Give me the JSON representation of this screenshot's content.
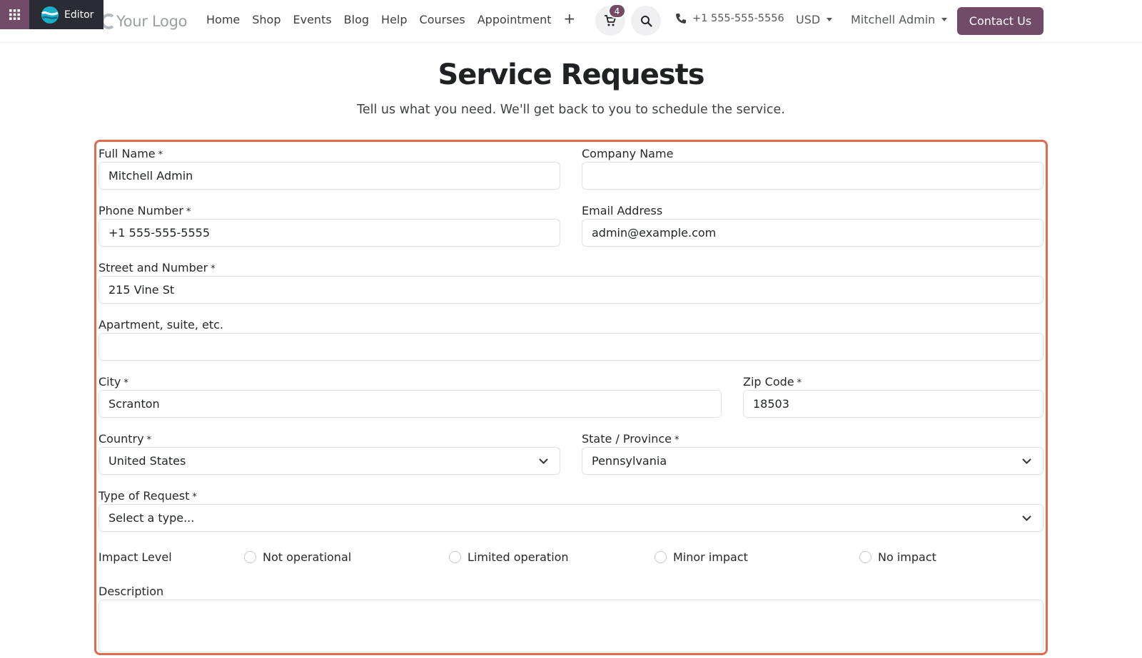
{
  "editor": {
    "label": "Editor"
  },
  "header": {
    "logo_text": "Your Logo",
    "nav": [
      "Home",
      "Shop",
      "Events",
      "Blog",
      "Help",
      "Courses",
      "Appointment"
    ],
    "nav_add": "+",
    "cart_count": "4",
    "phone": "+1 555-555-5556",
    "currency": "USD",
    "user": "Mitchell Admin",
    "contact_label": "Contact Us"
  },
  "page": {
    "title": "Service Requests",
    "subtitle": "Tell us what you need. We'll get back to you to schedule the service."
  },
  "form": {
    "required_mark": "*",
    "full_name": {
      "label": "Full Name",
      "value": "Mitchell Admin"
    },
    "company_name": {
      "label": "Company Name",
      "value": ""
    },
    "phone_number": {
      "label": "Phone Number",
      "value": "+1 555-555-5555"
    },
    "email": {
      "label": "Email Address",
      "value": "admin@example.com"
    },
    "street": {
      "label": "Street and Number",
      "value": "215 Vine St"
    },
    "apartment": {
      "label": "Apartment, suite, etc.",
      "value": ""
    },
    "city": {
      "label": "City",
      "value": "Scranton"
    },
    "zip": {
      "label": "Zip Code",
      "value": "18503"
    },
    "country": {
      "label": "Country",
      "value": "United States"
    },
    "state": {
      "label": "State / Province",
      "value": "Pennsylvania"
    },
    "request_type": {
      "label": "Type of Request",
      "value": "Select a type..."
    },
    "impact": {
      "label": "Impact Level",
      "options": [
        "Not operational",
        "Limited operation",
        "Minor impact",
        "No impact"
      ]
    },
    "description": {
      "label": "Description",
      "value": ""
    }
  },
  "colors": {
    "brand": "#714b67",
    "editor_bar": "#2b2b33",
    "form_highlight": "#e06a4f"
  },
  "icons": [
    "apps-grid-icon",
    "odoo-logo-icon",
    "logo-mark-icon",
    "cart-icon",
    "search-icon",
    "phone-icon",
    "chevron-down-icon"
  ]
}
